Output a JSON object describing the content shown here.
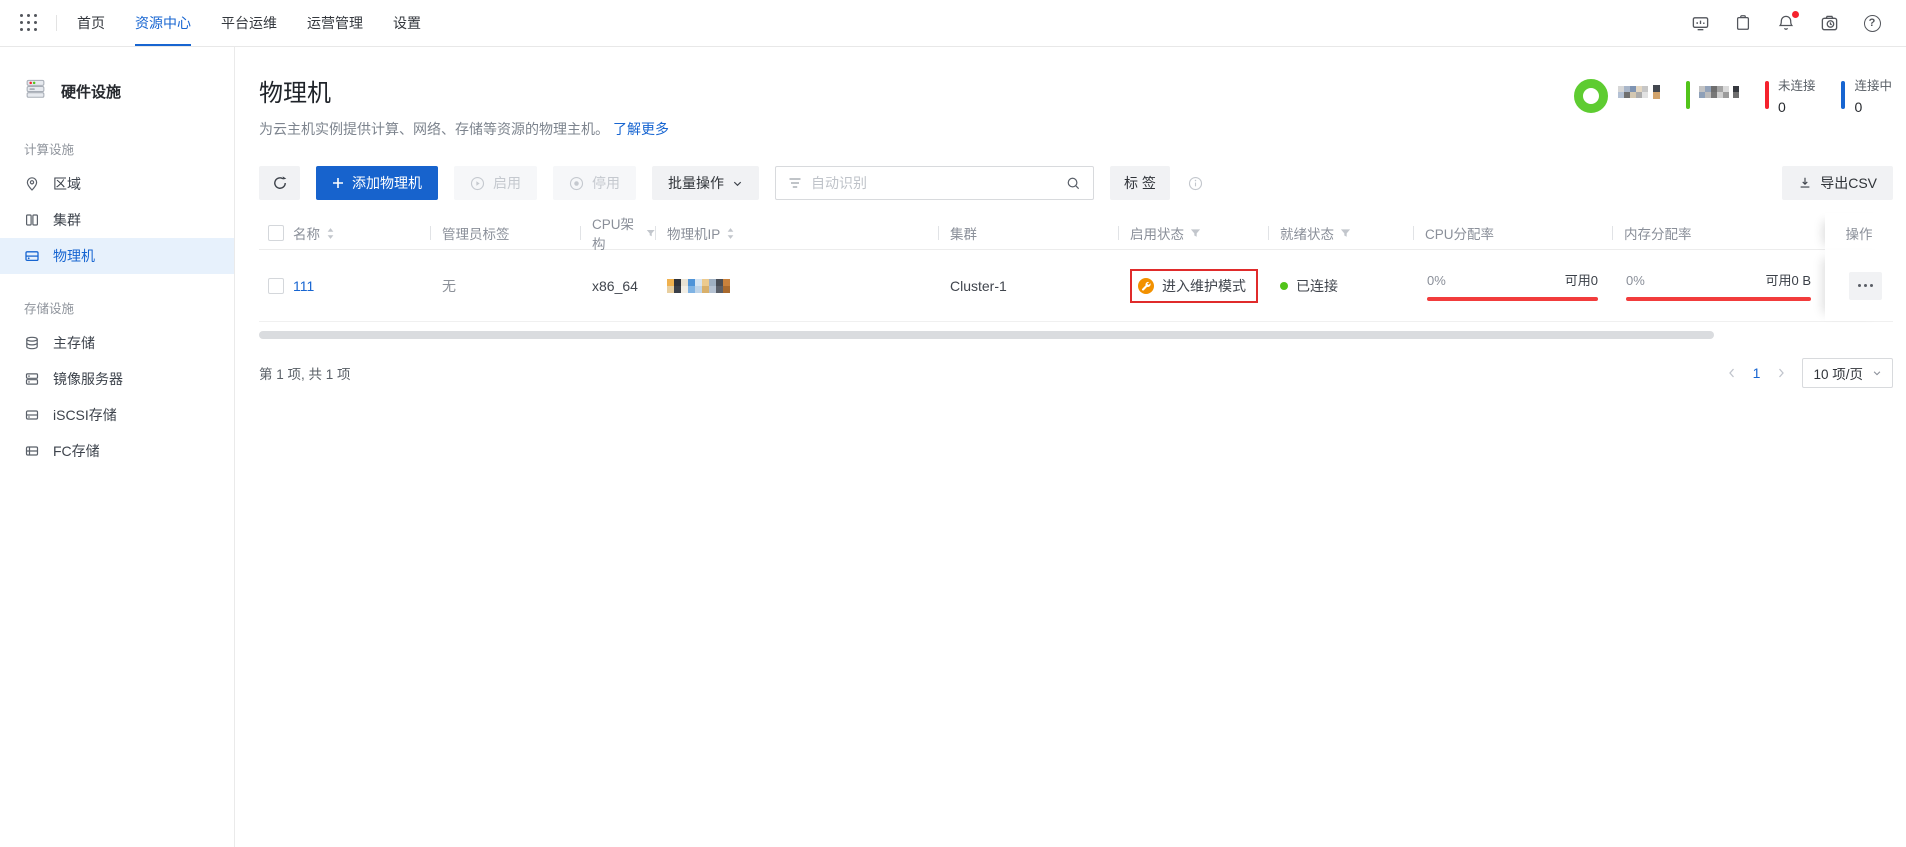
{
  "topnav": {
    "items": [
      {
        "label": "首页",
        "active": false
      },
      {
        "label": "资源中心",
        "active": true
      },
      {
        "label": "平台运维",
        "active": false
      },
      {
        "label": "运营管理",
        "active": false
      },
      {
        "label": "设置",
        "active": false
      }
    ]
  },
  "sidebar": {
    "title": "硬件设施",
    "sections": [
      {
        "label": "计算设施",
        "items": [
          {
            "label": "区域",
            "active": false
          },
          {
            "label": "集群",
            "active": false
          },
          {
            "label": "物理机",
            "active": true
          }
        ]
      },
      {
        "label": "存储设施",
        "items": [
          {
            "label": "主存储",
            "active": false
          },
          {
            "label": "镜像服务器",
            "active": false
          },
          {
            "label": "iSCSI存储",
            "active": false
          },
          {
            "label": "FC存储",
            "active": false
          }
        ]
      }
    ]
  },
  "page": {
    "title": "物理机",
    "subtitle": "为云主机实例提供计算、网络、存储等资源的物理主机。",
    "learn_more": "了解更多"
  },
  "widgets": {
    "donut_color": "#5ecc31",
    "connected_bar_color": "#52c41a",
    "disconnected": {
      "label": "未连接",
      "value": "0",
      "color": "#f5222d"
    },
    "connecting": {
      "label": "连接中",
      "value": "0",
      "color": "#1765d1"
    }
  },
  "toolbar": {
    "add_label": "添加物理机",
    "enable_label": "启用",
    "disable_label": "停用",
    "batch_label": "批量操作",
    "search_placeholder": "自动识别",
    "tag_label": "标 签",
    "export_label": "导出CSV"
  },
  "table": {
    "columns": [
      "名称",
      "管理员标签",
      "CPU架构",
      "物理机IP",
      "集群",
      "启用状态",
      "就绪状态",
      "CPU分配率",
      "内存分配率",
      "操作"
    ],
    "row": {
      "name": "111",
      "admin_tag": "无",
      "cpu_arch": "x86_64",
      "cluster": "Cluster-1",
      "enable_state": "进入维护模式",
      "ready_state": "已连接",
      "cpu_used": "0%",
      "cpu_avail": "可用0",
      "mem_used": "0%",
      "mem_avail": "可用0 B"
    }
  },
  "footer": {
    "summary": "第 1 项, 共 1 项",
    "page": "1",
    "page_size": "10 项/页"
  },
  "icons": {
    "help_glyph": "?"
  },
  "colors": {
    "accent": "#1765d1",
    "primary_button": "#1763cd",
    "bar_red": "#f23c3c",
    "highlight_red": "#e02b2b",
    "status_orange": "#f29100",
    "success_green": "#52c41a"
  },
  "redacted": {
    "hosts_label": {
      "cols": 5,
      "px": 6,
      "colors": [
        "#d7d7d7",
        "#a9b6c9",
        "#7e93b2",
        "#e4d7c2",
        "#c6c6c6",
        "#b4c1d4",
        "#707070",
        "#d3c7b1",
        "#ababab",
        "#e2e2e2"
      ]
    },
    "hosts_value": {
      "cols": 1,
      "px": 7,
      "colors": [
        "#43474f",
        "#d2a36b"
      ]
    },
    "connected_label": {
      "cols": 5,
      "px": 6,
      "colors": [
        "#c3c3c3",
        "#93a3ba",
        "#6e6e6e",
        "#a3a3a3",
        "#dadada",
        "#8ea0b8",
        "#bcbcbc",
        "#787878",
        "#cfcfcf",
        "#9b9b9b"
      ]
    },
    "connected_value": {
      "cols": 1,
      "px": 6,
      "colors": [
        "#35383e",
        "#6e6e6e"
      ]
    },
    "ip": {
      "cols": 9,
      "px": 7,
      "colors": [
        "#f0b14e",
        "#2f333b",
        "#e9e2d3",
        "#4f94d8",
        "#d7e5f2",
        "#ecca8e",
        "#9fb0c2",
        "#494d55",
        "#c8813c",
        "#e8cfa0",
        "#3a3f48",
        "#f3efe6",
        "#7fb3e4",
        "#bfd4e8",
        "#d9b06a",
        "#b5c2d2",
        "#5a5f68",
        "#a96a2e"
      ]
    }
  }
}
